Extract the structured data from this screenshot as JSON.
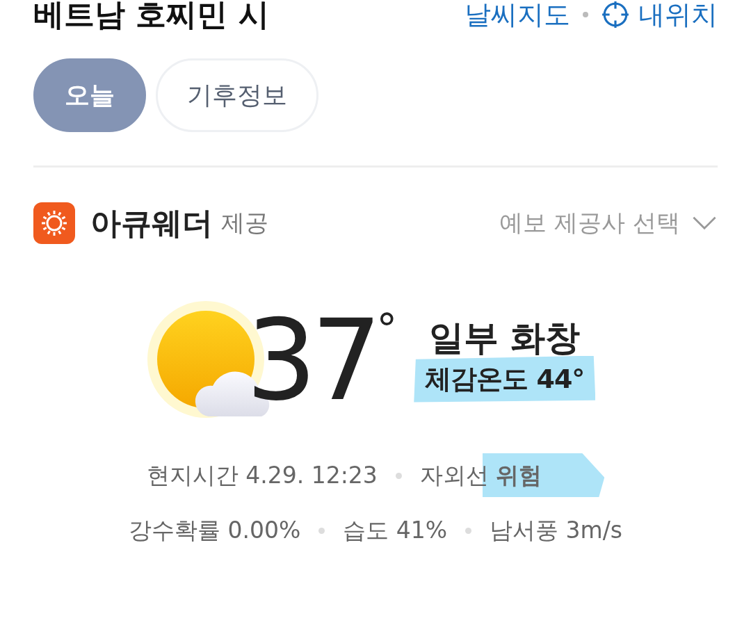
{
  "header": {
    "title": "베트남 호찌민 시",
    "links": [
      {
        "label": "날씨지도",
        "kind": "text"
      },
      {
        "label": "내위치",
        "kind": "location"
      }
    ]
  },
  "tabs": [
    {
      "label": "오늘",
      "selected": true
    },
    {
      "label": "기후정보",
      "selected": false
    }
  ],
  "provider": {
    "name": "아큐웨더",
    "suffix": "제공",
    "selector": "예보 제공사 선택"
  },
  "current": {
    "temperature": "37$^{°}$",
    "condition": "일부 화창",
    "feels_like": "체감온도 44°"
  },
  "details": [
    [
      {
        "text": "현지시간 4.29. 12:23",
        "highlighted": false
      },
      {
        "text": "자외선 **위험**",
        "highlighted": true
      }
    ],
    [
      {
        "text": "강수확률 0.00%",
        "highlighted": false
      },
      {
        "text": "습도 41%",
        "highlighted": false
      },
      {
        "text": "남서풍 3m/s",
        "highlighted": false
      }
    ]
  ]
}
